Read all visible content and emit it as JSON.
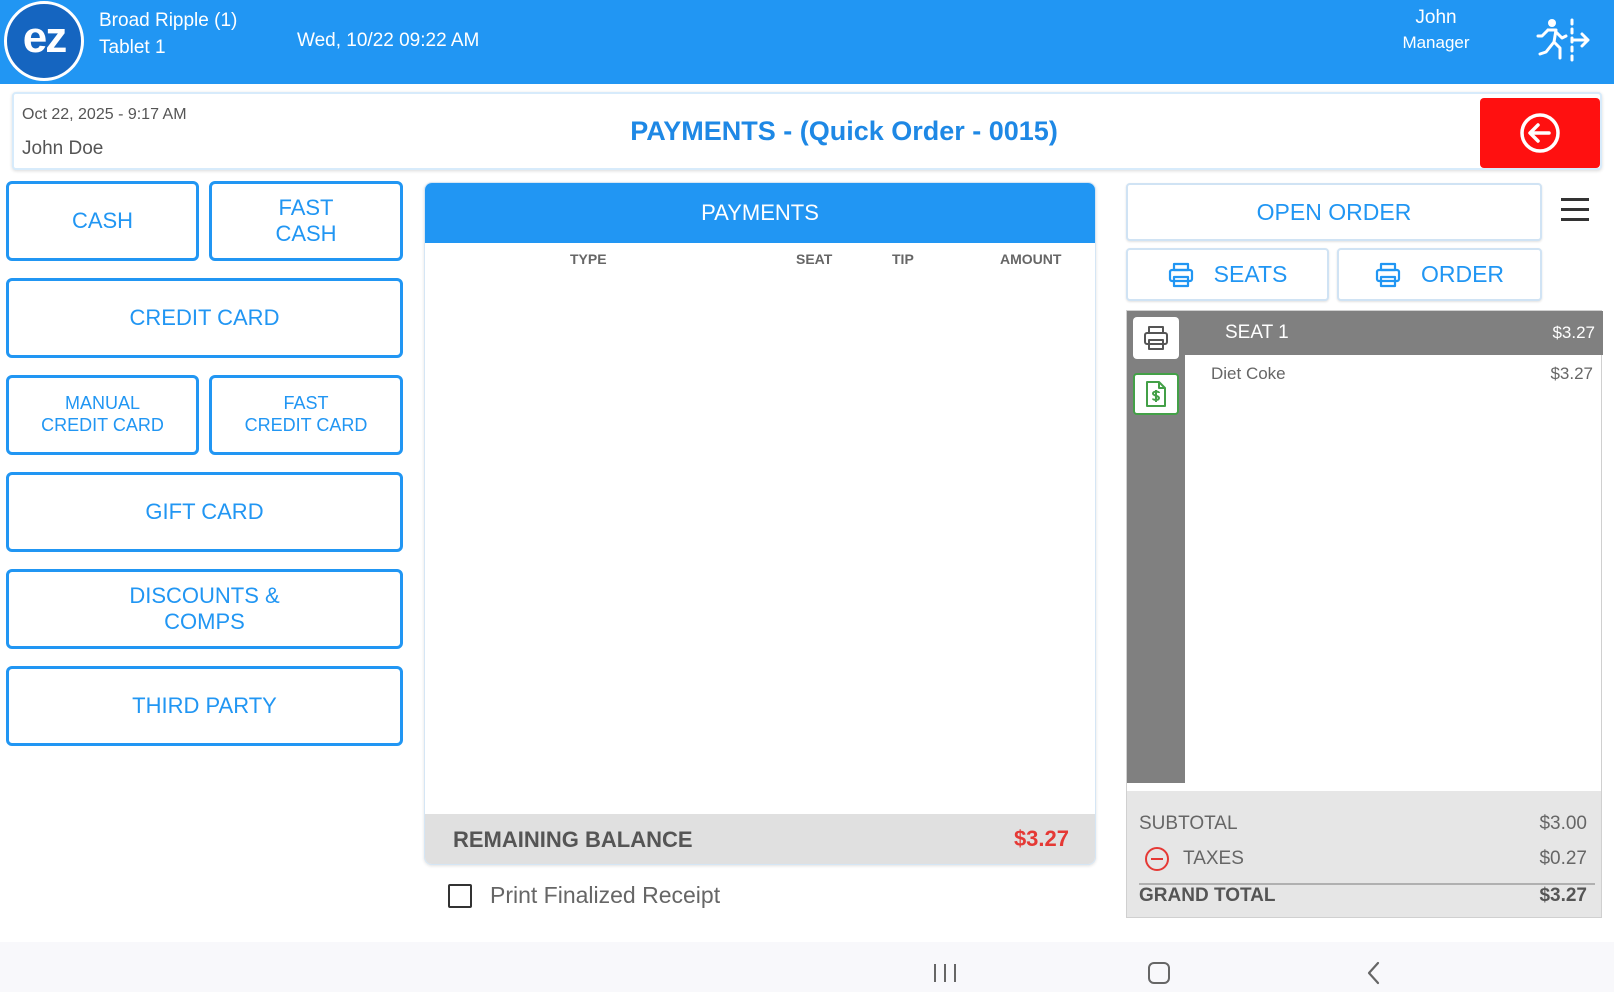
{
  "topbar": {
    "logo_text": "ez",
    "store": "Broad Ripple (1)",
    "device": "Tablet 1",
    "datetime": "Wed, 10/22 09:22 AM",
    "user_name": "John",
    "user_role": "Manager"
  },
  "header": {
    "order_datetime": "Oct 22, 2025  - 9:17 AM",
    "customer": "John Doe",
    "title": "PAYMENTS - (Quick Order - 0015)"
  },
  "payment_methods": {
    "cash": "CASH",
    "fast_cash": "FAST\nCASH",
    "credit_card": "CREDIT CARD",
    "manual_credit_card": "MANUAL\nCREDIT CARD",
    "fast_credit_card": "FAST\nCREDIT CARD",
    "gift_card": "GIFT CARD",
    "discounts_comps": "DISCOUNTS &\nCOMPS",
    "third_party": "THIRD PARTY"
  },
  "payments": {
    "header": "PAYMENTS",
    "columns": [
      "TYPE",
      "SEAT",
      "TIP",
      "AMOUNT"
    ],
    "rows": [],
    "remaining_label": "REMAINING BALANCE",
    "remaining_value": "$3.27",
    "print_receipt_label": "Print Finalized Receipt",
    "print_receipt_checked": false
  },
  "order_actions": {
    "open_order": "OPEN ORDER",
    "seats": "SEATS",
    "order": "ORDER"
  },
  "order": {
    "seats": [
      {
        "name": "SEAT 1",
        "amount": "$3.27",
        "items": [
          {
            "name": "Diet Coke",
            "price": "$3.27"
          }
        ]
      }
    ],
    "subtotal_label": "SUBTOTAL",
    "subtotal": "$3.00",
    "taxes_label": "TAXES",
    "taxes": "$0.27",
    "grand_total_label": "GRAND TOTAL",
    "grand_total": "$3.27"
  },
  "icons": {
    "logout": "walking-person-exit-icon",
    "back": "arrow-left-circle-icon",
    "printer": "printer-icon",
    "bill": "dollar-receipt-icon",
    "menu": "hamburger-menu-icon",
    "remove_tax": "minus-circle-icon"
  },
  "colors": {
    "primary": "#2196f3",
    "back_button": "#ff1010",
    "balance_due": "#e53935",
    "sidebar_gray": "#808080"
  }
}
